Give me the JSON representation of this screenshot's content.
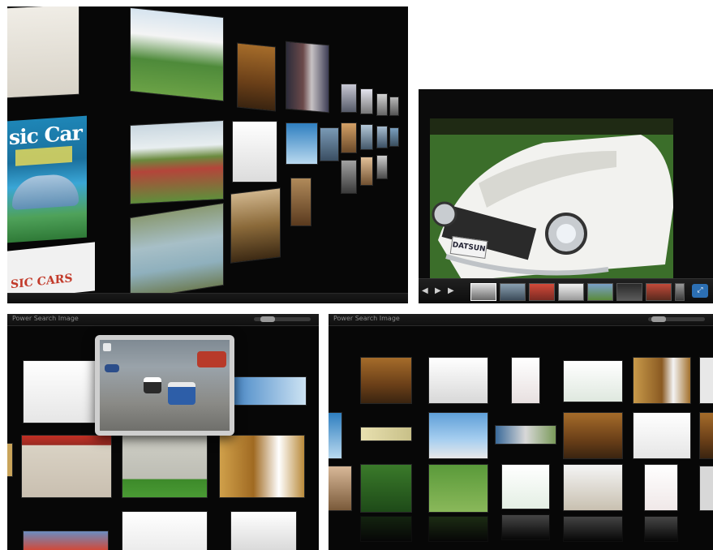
{
  "panel1": {
    "magazine_title": "sic Car",
    "lower_card_text": "SIC CARS",
    "tiles": [
      {
        "style": "paper"
      },
      {
        "style": "photo1"
      },
      {
        "style": "room"
      },
      {
        "style": "people"
      },
      {
        "style": "photo2"
      },
      {
        "style": "paper"
      },
      {
        "style": "blue"
      },
      {
        "style": "photo3"
      },
      {
        "style": "dark"
      },
      {
        "style": "room"
      }
    ]
  },
  "panel2": {
    "license_plate": "DATSUN",
    "nav": {
      "prev": "◀",
      "play": "▶",
      "next": "▶"
    },
    "thumbnail_count": 8,
    "selected_thumbnail": 1,
    "expand_icon": "fullscreen-icon"
  },
  "panel3": {
    "header_title": "Power Search Image",
    "popup_subject": "go-kart race"
  },
  "panel4": {
    "header_title": "Power Search Image",
    "tiles": [
      "room",
      "scooter",
      "scooter-red",
      "minibike",
      "room",
      "ticket",
      "sky",
      "ticket",
      "room",
      "scooter-black",
      "room",
      "scooter",
      "minibike",
      "scooter",
      "bag"
    ]
  },
  "colors": {
    "panel_bg": "#070707",
    "accent_blue": "#2c6fb3",
    "highlight": "#ffffff"
  }
}
